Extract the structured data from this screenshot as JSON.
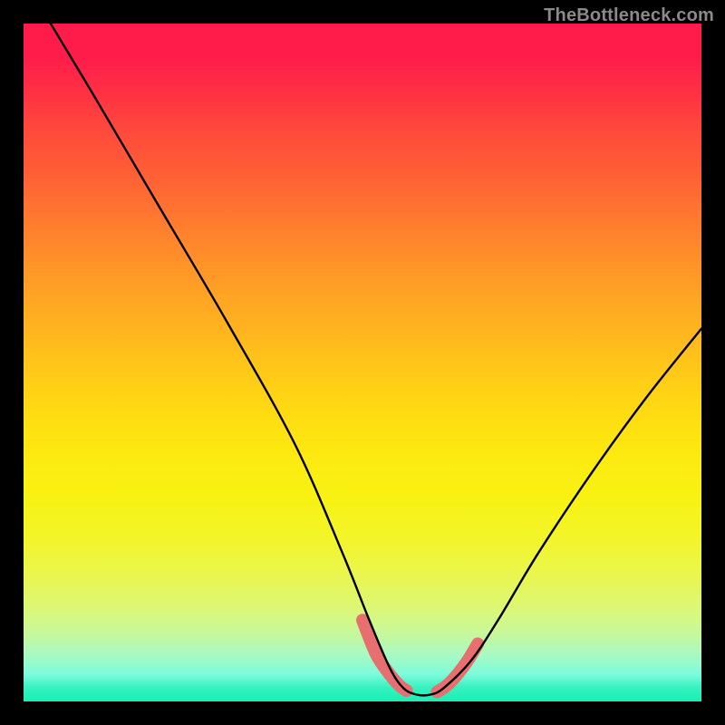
{
  "attribution": "TheBottleneck.com",
  "chart_data": {
    "type": "line",
    "title": "",
    "xlabel": "",
    "ylabel": "",
    "ylim": [
      0,
      100
    ],
    "xlim": [
      0,
      100
    ],
    "series": [
      {
        "name": "bottleneck-curve",
        "x": [
          4,
          10,
          20,
          30,
          40,
          47,
          51,
          54,
          56,
          58,
          60,
          62,
          66,
          70,
          76,
          84,
          92,
          100
        ],
        "y": [
          100,
          90,
          73,
          56,
          38,
          22,
          12,
          5,
          2,
          1,
          1,
          2,
          6,
          12,
          22,
          34,
          45,
          55
        ]
      }
    ],
    "highlight_segments": [
      {
        "name": "left-near-min",
        "x": [
          50,
          52,
          54,
          55.5,
          56.5
        ],
        "y": [
          12,
          7,
          4,
          2.3,
          1.6
        ]
      },
      {
        "name": "right-near-min",
        "x": [
          61,
          62.5,
          64,
          65.5,
          67
        ],
        "y": [
          1.4,
          2.4,
          4,
          6,
          8.5
        ]
      }
    ],
    "colors": {
      "curve": "#000000",
      "highlight": "#e76f6f",
      "gradient_top": "#ff1c4b",
      "gradient_bottom": "#18f0b3"
    }
  }
}
